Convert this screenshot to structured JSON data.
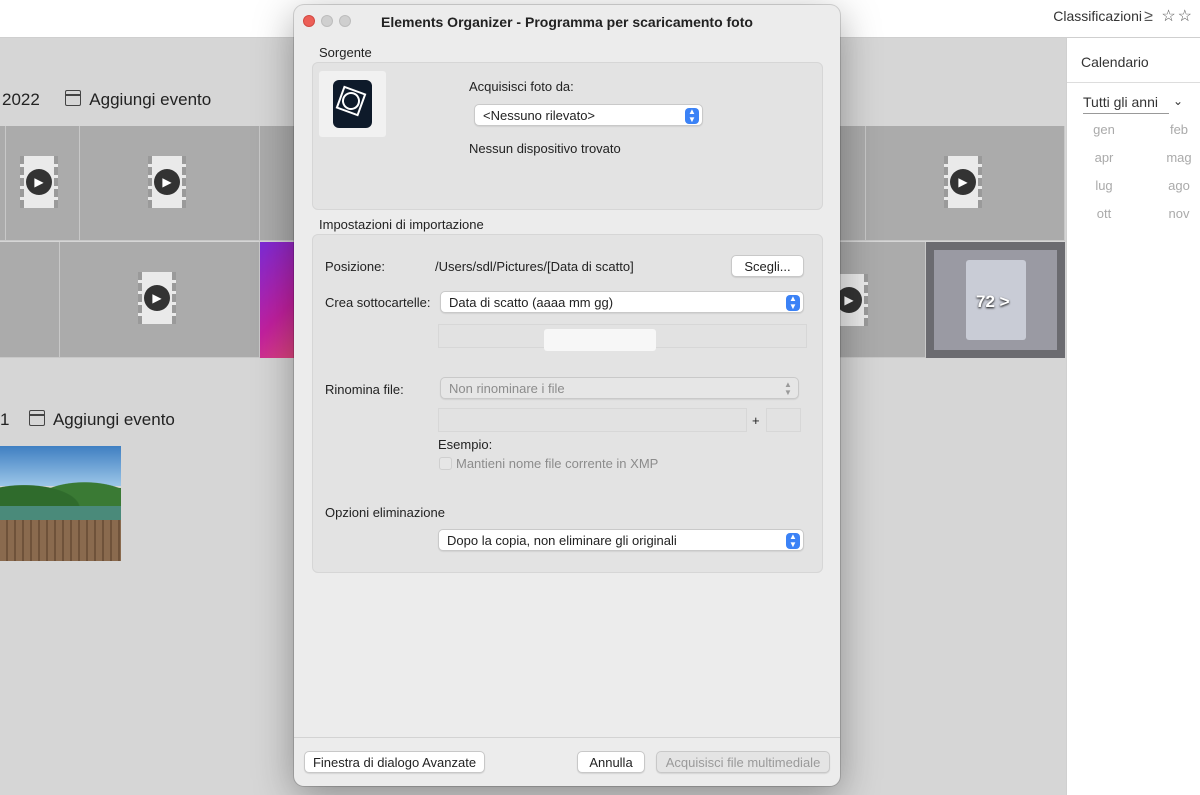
{
  "background": {
    "topbar": {
      "classifications": "Classificazioni",
      "sort_symbol": "≥",
      "stars": "☆☆"
    },
    "event1": {
      "year": "2022",
      "add_event": "Aggiungi evento"
    },
    "event2": {
      "year": "1",
      "add_event": "Aggiungi evento"
    },
    "stack_count": "72 >",
    "sidebar": {
      "title": "Calendario",
      "years_select": "Tutti gli anni",
      "months": [
        "gen",
        "feb",
        "apr",
        "mag",
        "lug",
        "ago",
        "ott",
        "nov"
      ]
    }
  },
  "dialog": {
    "title": "Elements Organizer - Programma per scaricamento foto",
    "source": {
      "section_label": "Sorgente",
      "acquire_from_label": "Acquisisci foto da:",
      "device_select": "<Nessuno rilevato>",
      "status": "Nessun dispositivo trovato"
    },
    "import": {
      "section_label": "Impostazioni di importazione",
      "location_label": "Posizione:",
      "location_path": "/Users/sdl/Pictures/[Data di scatto]",
      "choose_button": "Scegli...",
      "subfolders_label": "Crea sottocartelle:",
      "subfolders_select": "Data di scatto (aaaa mm gg)",
      "rename_label": "Rinomina file:",
      "rename_select": "Non rinominare i file",
      "plus": "+",
      "example_label": "Esempio:",
      "keep_name_label": "Mantieni nome file corrente in XMP",
      "delete_label": "Opzioni eliminazione",
      "delete_select": "Dopo la copia, non eliminare gli originali"
    },
    "footer": {
      "advanced_button": "Finestra di dialogo Avanzate",
      "cancel_button": "Annulla",
      "acquire_button": "Acquisisci file multimediale"
    },
    "colors": {
      "accent": "#3b82f6",
      "close": "#ec5f57",
      "inactive_dot": "#cfcfcf"
    }
  }
}
